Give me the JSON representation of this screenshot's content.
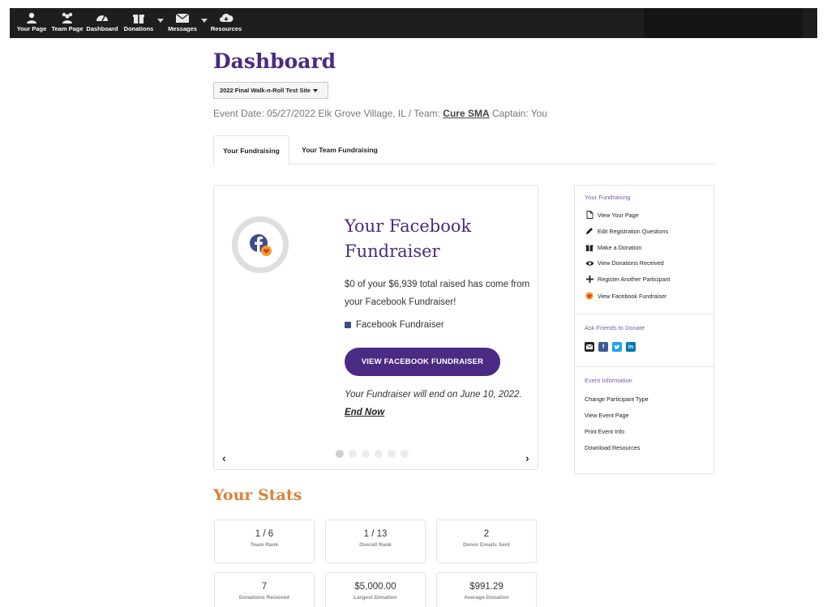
{
  "nav": {
    "items": [
      {
        "label": "Your Page",
        "icon": "user-icon"
      },
      {
        "label": "Team Page",
        "icon": "team-icon"
      },
      {
        "label": "Dashboard",
        "icon": "dashboard-icon"
      },
      {
        "label": "Donations",
        "icon": "gift-icon"
      },
      {
        "label": "Messages",
        "icon": "envelope-icon"
      },
      {
        "label": "Resources",
        "icon": "cloud-icon"
      }
    ]
  },
  "header": {
    "title": "Dashboard",
    "site_select": "2022 Final Walk-n-Roll Test Site",
    "event_prefix": "Event Date: 05/27/2022  Elk Grove Village, IL  /  Team: ",
    "team_name": "Cure SMA",
    "captain": "  Captain: You"
  },
  "tabs": [
    {
      "label": "Your Fundraising",
      "active": true
    },
    {
      "label": "Your Team Fundraising",
      "active": false
    }
  ],
  "carousel": {
    "heading": "Your Facebook Fundraiser",
    "raised_text": "$0 of your $6,939 total raised has come from your Facebook Fundraiser!",
    "legend_label": "Facebook Fundraiser",
    "legend_color": "#3b4b8e",
    "button_label": "VIEW FACEBOOK FUNDRAISER",
    "end_text": "Your Fundraiser will end on June 10, 2022. ",
    "end_link": "End Now",
    "prev": "‹",
    "next": "›",
    "slide_count": 6,
    "active_slide": 1
  },
  "sidebar": {
    "fundraising_title": "Your Fundraising",
    "links": [
      {
        "label": "View Your Page",
        "icon": "page-icon"
      },
      {
        "label": "Edit Registration Questions",
        "icon": "pencil-icon"
      },
      {
        "label": "Make a Donation",
        "icon": "gift-icon"
      },
      {
        "label": "View Donations Received",
        "icon": "eye-icon"
      },
      {
        "label": "Register Another Participant",
        "icon": "plus-icon"
      },
      {
        "label": "View Facebook Fundraiser",
        "icon": "heart-emoji-icon"
      }
    ],
    "ask_title": "Ask Friends to Donate",
    "share_icons": [
      "email-icon",
      "facebook-icon",
      "twitter-icon",
      "linkedin-icon"
    ],
    "event_title": "Event Information",
    "event_links": [
      "Change Participant Type",
      "View Event Page",
      "Print Event Info",
      "Download Resources"
    ]
  },
  "stats": {
    "title": "Your Stats",
    "items": [
      {
        "value": "1 / 6",
        "label": "Team Rank"
      },
      {
        "value": "1 / 13",
        "label": "Overall Rank"
      },
      {
        "value": "2",
        "label": "Donor Emails Sent"
      },
      {
        "value": "7",
        "label": "Donations Received"
      },
      {
        "value": "$5,000.00",
        "label": "Largest Donation"
      },
      {
        "value": "$991.29",
        "label": "Average Donation"
      }
    ]
  },
  "colors": {
    "brand_purple": "#4b2a82",
    "accent_orange": "#d9823b",
    "nav_bg": "#1e1e1e"
  }
}
